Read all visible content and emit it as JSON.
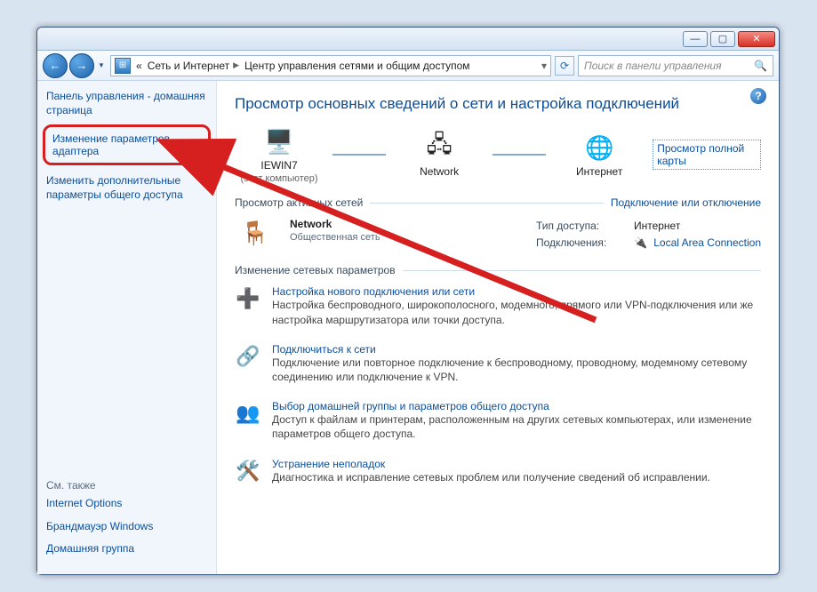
{
  "titlebar": {
    "min": "—",
    "max": "▢",
    "close": "✕"
  },
  "nav": {
    "back": "←",
    "forward": "→",
    "dropdown": "▼",
    "addr_prefix": "«",
    "breadcrumb": [
      "Сеть и Интернет",
      "Центр управления сетями и общим доступом"
    ],
    "refresh": "⟳",
    "search_placeholder": "Поиск в панели управления"
  },
  "sidebar": {
    "home": "Панель управления - домашняя страница",
    "adapter": "Изменение параметров адаптера",
    "sharing": "Изменить дополнительные параметры общего доступа",
    "see_also_title": "См. также",
    "see_also": [
      "Internet Options",
      "Брандмауэр Windows",
      "Домашняя группа"
    ]
  },
  "main": {
    "help": "?",
    "title": "Просмотр основных сведений о сети и настройка подключений",
    "netmap": {
      "node1_label": "IEWIN7",
      "node1_sub": "(этот компьютер)",
      "node2_label": "Network",
      "node3_label": "Интернет",
      "fullmap": "Просмотр полной карты"
    },
    "active_section": "Просмотр активных сетей",
    "active_right": "Подключение или отключение",
    "active_net": {
      "name": "Network",
      "type": "Общественная сеть",
      "access_k": "Тип доступа:",
      "access_v": "Интернет",
      "conn_k": "Подключения:",
      "conn_v": "Local Area Connection"
    },
    "settings_section": "Изменение сетевых параметров",
    "tasks": [
      {
        "title": "Настройка нового подключения или сети",
        "desc": "Настройка беспроводного, широкополосного, модемного, прямого или VPN-подключения или же настройка маршрутизатора или точки доступа."
      },
      {
        "title": "Подключиться к сети",
        "desc": "Подключение или повторное подключение к беспроводному, проводному, модемному сетевому соединению или подключение к VPN."
      },
      {
        "title": "Выбор домашней группы и параметров общего доступа",
        "desc": "Доступ к файлам и принтерам, расположенным на других сетевых компьютерах, или изменение параметров общего доступа."
      },
      {
        "title": "Устранение неполадок",
        "desc": "Диагностика и исправление сетевых проблем или получение сведений об исправлении."
      }
    ]
  }
}
